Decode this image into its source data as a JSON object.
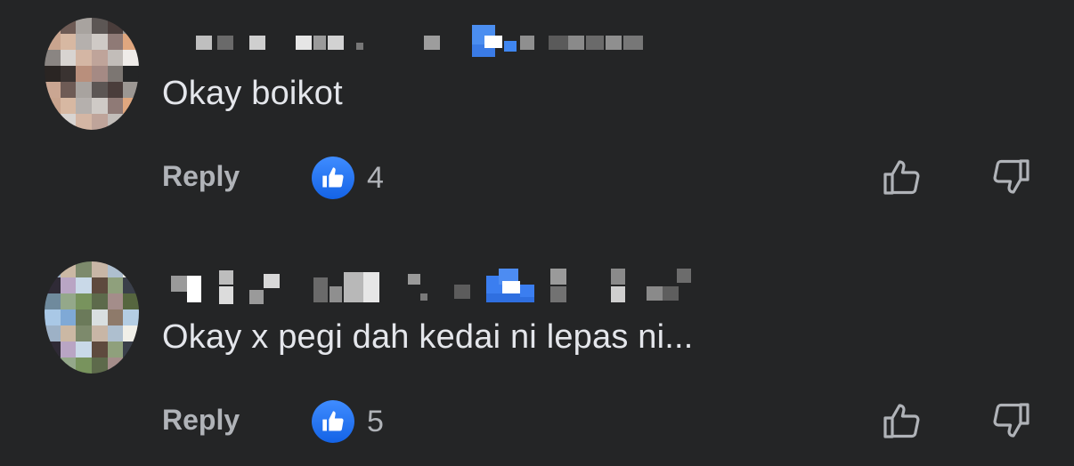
{
  "colors": {
    "background": "#242526",
    "text_primary": "#e4e6eb",
    "text_secondary": "#b0b3b8",
    "reaction_blue": "#1877f2"
  },
  "comments": [
    {
      "text": "Okay boikot",
      "reply_label": "Reply",
      "reaction_icon": "thumbs-up-icon",
      "reaction_count": "4",
      "upvote_icon": "thumbs-up-outline-icon",
      "downvote_icon": "thumbs-down-outline-icon"
    },
    {
      "text": "Okay x pegi dah kedai ni lepas ni...",
      "reply_label": "Reply",
      "reaction_icon": "thumbs-up-icon",
      "reaction_count": "5",
      "upvote_icon": "thumbs-up-outline-icon",
      "downvote_icon": "thumbs-down-outline-icon"
    }
  ]
}
